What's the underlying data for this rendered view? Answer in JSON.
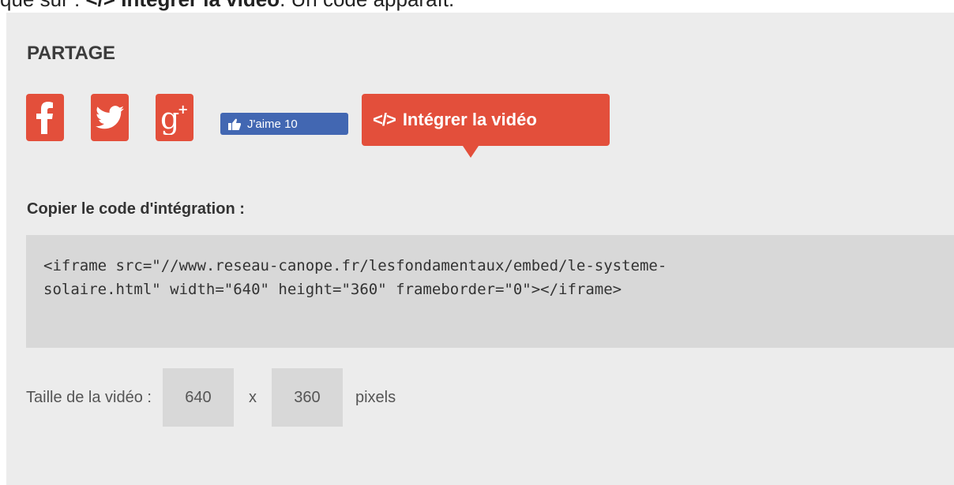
{
  "caption": {
    "prefix": "que sur : ",
    "bold": "</> Intégrer la vidéo",
    "suffix": ". Un code apparaît."
  },
  "share": {
    "title": "PARTAGE",
    "like": {
      "label": "J'aime",
      "count": "10"
    },
    "embed_button": {
      "icon_text": "</>",
      "label": "Intégrer la vidéo"
    },
    "icons": [
      "facebook-icon",
      "twitter-icon",
      "google-plus-icon",
      "thumbs-up-icon"
    ],
    "accent_color": "#e34f3b",
    "like_color": "#4267b2"
  },
  "embed": {
    "label": "Copier le code d'intégration :",
    "code_line1": "<iframe src=\"//www.reseau-canope.fr/lesfondamentaux/embed/le-systeme-",
    "code_line2": "solaire.html\" width=\"640\" height=\"360\" frameborder=\"0\"></iframe>"
  },
  "size": {
    "label": "Taille de la vidéo :",
    "width": "640",
    "separator": "x",
    "height": "360",
    "unit": "pixels"
  }
}
